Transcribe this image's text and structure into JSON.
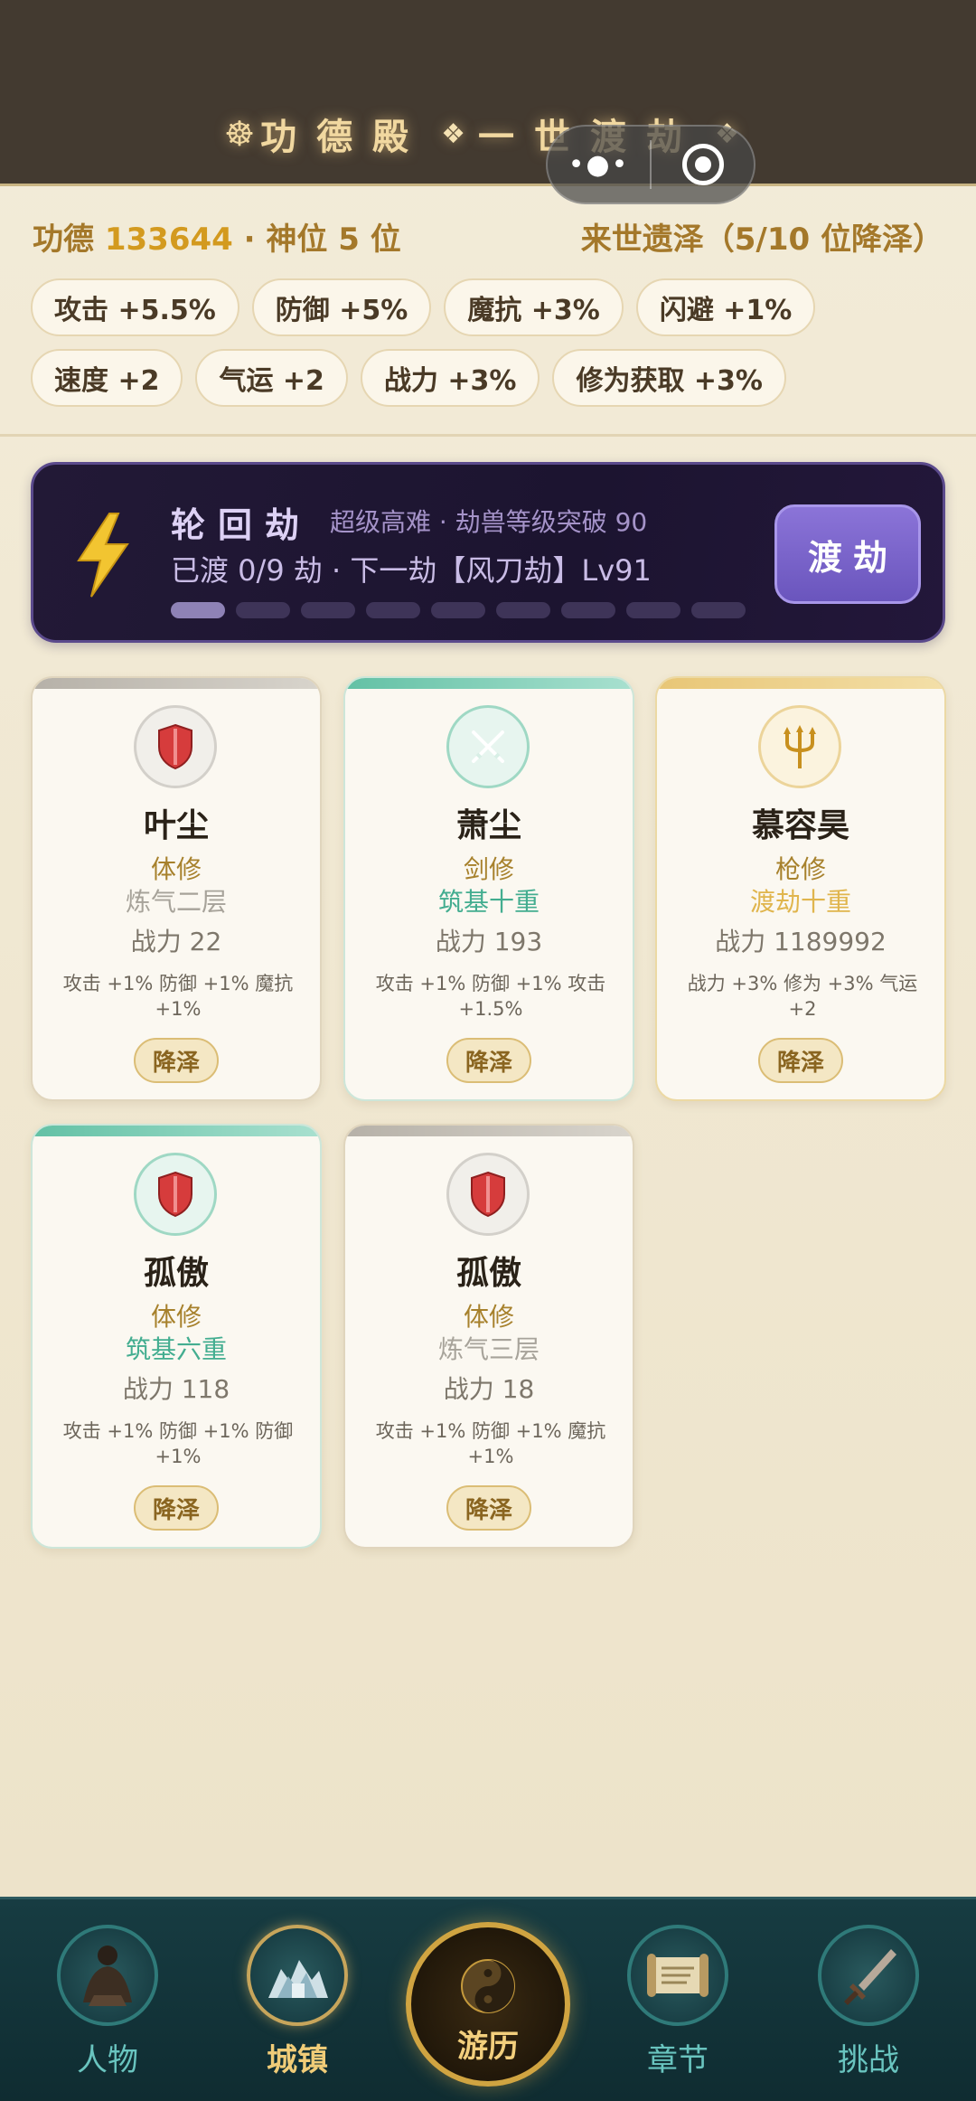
{
  "header": {
    "title_main": "功德殿",
    "title_sub": "一世渡劫"
  },
  "stats": {
    "merit_label": "功德",
    "merit_value": "133644",
    "rank_text": "· 神位 5 位",
    "legacy_text": "来世遗泽（5/10 位降泽）"
  },
  "buffs": [
    "攻击 +5.5%",
    "防御 +5%",
    "魔抗 +3%",
    "闪避 +1%",
    "速度 +2",
    "气运 +2",
    "战力 +3%",
    "修为获取 +3%"
  ],
  "tribulation": {
    "title": "轮回劫",
    "subtitle": "超级高难 · 劫兽等级突破 90",
    "progress_text": "已渡 0/9 劫 · 下一劫【风刀劫】Lv91",
    "progress": {
      "done": 0,
      "total": 9
    },
    "button_label": "渡劫"
  },
  "cards": [
    {
      "name": "叶尘",
      "class": "体修",
      "realm": "炼气二层",
      "power": "战力 22",
      "bonus": "攻击 +1% 防御 +1% 魔抗 +1%",
      "button": "降泽",
      "tier": "gray",
      "icon": "shield-icon"
    },
    {
      "name": "萧尘",
      "class": "剑修",
      "realm": "筑基十重",
      "power": "战力 193",
      "bonus": "攻击 +1% 防御 +1% 攻击 +1.5%",
      "button": "降泽",
      "tier": "jade",
      "icon": "crossed-swords-icon"
    },
    {
      "name": "慕容昊",
      "class": "枪修",
      "realm": "渡劫十重",
      "power": "战力 1189992",
      "bonus": "战力 +3% 修为 +3% 气运 +2",
      "button": "降泽",
      "tier": "gold",
      "icon": "trident-icon"
    },
    {
      "name": "孤傲",
      "class": "体修",
      "realm": "筑基六重",
      "power": "战力 118",
      "bonus": "攻击 +1% 防御 +1% 防御 +1%",
      "button": "降泽",
      "tier": "jade",
      "icon": "shield-icon"
    },
    {
      "name": "孤傲",
      "class": "体修",
      "realm": "炼气三层",
      "power": "战力 18",
      "bonus": "攻击 +1% 防御 +1% 魔抗 +1%",
      "button": "降泽",
      "tier": "gray",
      "icon": "shield-icon"
    }
  ],
  "nav": [
    {
      "label": "人物",
      "icon": "character-icon",
      "active": false
    },
    {
      "label": "城镇",
      "icon": "town-icon",
      "active": true
    },
    {
      "label": "游历",
      "icon": "yin-yang-icon",
      "active": false
    },
    {
      "label": "章节",
      "icon": "scroll-icon",
      "active": false
    },
    {
      "label": "挑战",
      "icon": "sword-icon",
      "active": false
    }
  ],
  "colors": {
    "header_bg": "#433a30",
    "accent_gold": "#d39a1f",
    "banner_bg": "#1c1430",
    "banner_button": "#7a64cc",
    "jade": "#43ad90",
    "nav_bg": "#173c42"
  }
}
